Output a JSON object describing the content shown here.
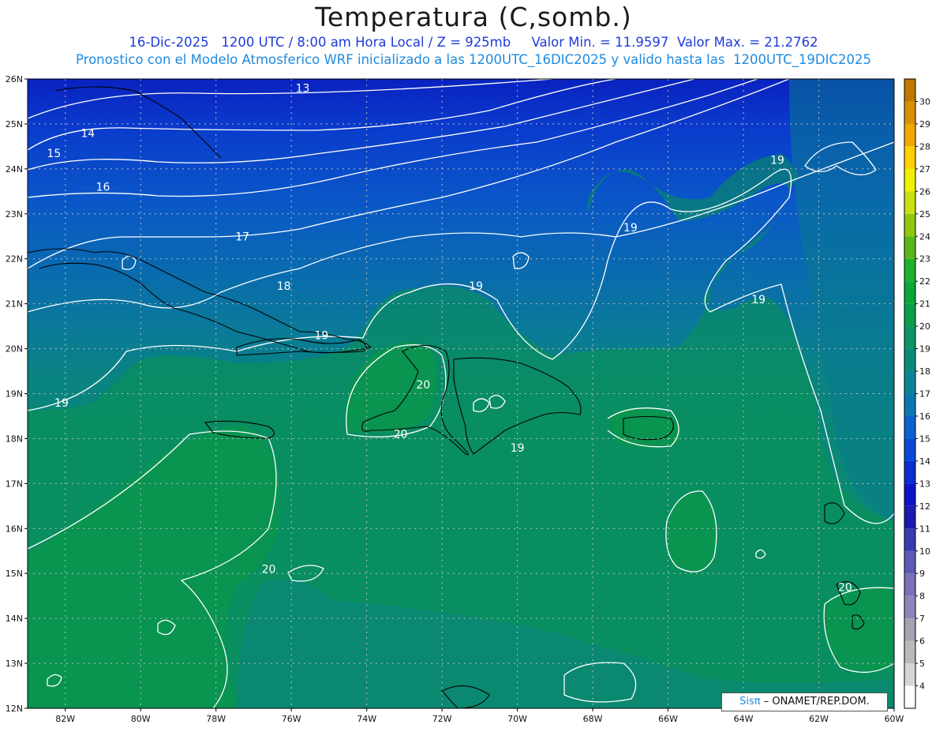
{
  "header": {
    "title": "Temperatura (C,somb.)",
    "line1": "16-Dic-2025   1200 UTC / 8:00 am Hora Local / Z = 925mb     Valor Min. = 11.9597  Valor Max. = 21.2762",
    "line2": "Pronostico con el Modelo Atmosferico WRF inicializado a las 1200UTC_16DIC2025 y valido hasta las  1200UTC_19DIC2025"
  },
  "map": {
    "lon_range": [
      -83,
      -60
    ],
    "lat_range": [
      12,
      26
    ],
    "lon_ticks": [
      "82W",
      "80W",
      "78W",
      "76W",
      "74W",
      "72W",
      "70W",
      "68W",
      "66W",
      "64W",
      "62W",
      "60W"
    ],
    "lat_ticks": [
      "12N",
      "13N",
      "14N",
      "15N",
      "16N",
      "17N",
      "18N",
      "19N",
      "20N",
      "21N",
      "22N",
      "23N",
      "24N",
      "25N",
      "26N"
    ],
    "contour_labels": [
      "13",
      "14",
      "15",
      "16",
      "17",
      "18",
      "19",
      "19",
      "19",
      "19",
      "19",
      "19",
      "20",
      "20",
      "20"
    ]
  },
  "colorbar": {
    "labels": [
      "4",
      "5",
      "6",
      "7",
      "8",
      "9",
      "10",
      "11",
      "12",
      "13",
      "14",
      "15",
      "16",
      "17",
      "18",
      "19",
      "20",
      "21",
      "22",
      "23",
      "24",
      "25",
      "26",
      "27",
      "28",
      "29",
      "30"
    ],
    "colors": [
      "#ffffff",
      "#d6d6d6",
      "#b9b9b9",
      "#a3a3b3",
      "#8f84bb",
      "#7a6fb8",
      "#5c5cb6",
      "#3a3ab0",
      "#1a1ab0",
      "#0a14c8",
      "#0a2ed0",
      "#0a48d8",
      "#0a62d0",
      "#0a78b0",
      "#0a8496",
      "#0a8a78",
      "#0a9462",
      "#0a9e48",
      "#0aa838",
      "#20b02a",
      "#58b81a",
      "#90c810",
      "#c8e010",
      "#f0f000",
      "#ffd000",
      "#f0a800",
      "#d89000",
      "#c07800"
    ]
  },
  "credit": {
    "brand": "Sisπ",
    "text": "– ONAMET/REP.DOM."
  }
}
